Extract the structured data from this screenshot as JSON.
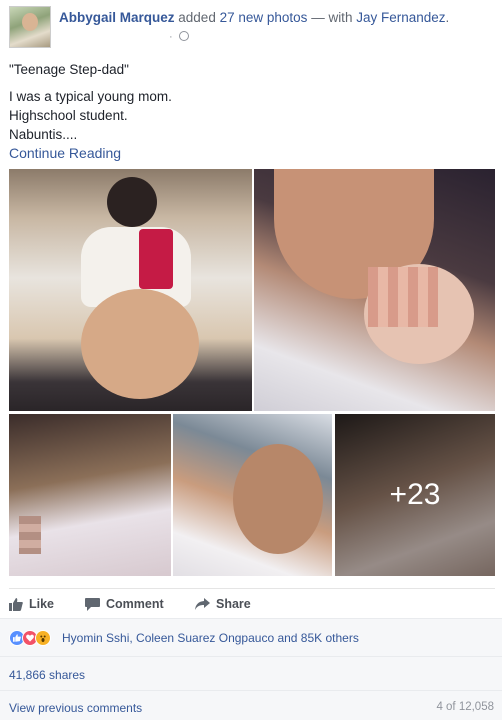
{
  "post": {
    "author": "Abbygail Marquez",
    "action_prefix": "added",
    "action_count_text": "27 new photos",
    "with_text": "— with",
    "tagged": "Jay Fernandez",
    "headline_end": "."
  },
  "content": {
    "title": "\"Teenage Step-dad\"",
    "lines": [
      "I was a typical young mom.",
      "Highschool student.",
      "Nabuntis...."
    ],
    "continue": "Continue Reading"
  },
  "photos": {
    "more_overlay": "+23"
  },
  "actions": {
    "like": "Like",
    "comment": "Comment",
    "share": "Share"
  },
  "reactions": {
    "summary": "Hyomin Sshi, Coleen Suarez Ongpauco and 85K others",
    "icons": [
      "like-reaction-icon",
      "love-reaction-icon",
      "wow-reaction-icon"
    ]
  },
  "shares": {
    "text": "41,866 shares"
  },
  "comments": {
    "view_previous": "View previous comments",
    "count": "4 of 12,058"
  },
  "colors": {
    "link": "#365899",
    "meta": "#90949c",
    "action": "#4b4f56",
    "panel": "#f6f7f9"
  }
}
